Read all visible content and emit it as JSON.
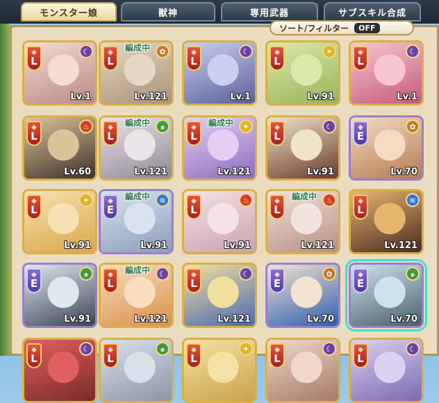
{
  "tabs": [
    {
      "label": "モンスター娘",
      "active": true
    },
    {
      "label": "獣神",
      "active": false
    },
    {
      "label": "専用武器",
      "active": false
    },
    {
      "label": "サブスキル合成",
      "active": false
    }
  ],
  "sort_filter": {
    "label": "ソート/フィルター",
    "state": "OFF"
  },
  "rank_symbols": {
    "L": "L",
    "E": "E"
  },
  "party_label": "編成中",
  "attr_colors": {
    "dark": "#6a3fa8",
    "fire": "#d63c1f",
    "light": "#e0b424",
    "wind": "#3f9a3c",
    "water": "#2f78d6",
    "earth": "#c07a2c"
  },
  "cards": [
    {
      "rank": "L",
      "attr": "dark",
      "level": "Lv.1",
      "party": false,
      "palette": [
        "#f2dccf",
        "#b98a86"
      ]
    },
    {
      "rank": "L",
      "attr": "earth",
      "level": "Lv.121",
      "party": true,
      "palette": [
        "#e6d8c4",
        "#a99278"
      ]
    },
    {
      "rank": "L",
      "attr": "dark",
      "level": "Lv.1",
      "party": false,
      "palette": [
        "#c9d0ef",
        "#5a5f9a"
      ]
    },
    {
      "rank": "L",
      "attr": "light",
      "level": "Lv.91",
      "party": false,
      "palette": [
        "#d9e9a7",
        "#9bb35a"
      ]
    },
    {
      "rank": "L",
      "attr": "dark",
      "level": "Lv.1",
      "party": false,
      "palette": [
        "#f6c7d1",
        "#c65b79"
      ]
    },
    {
      "rank": "L",
      "attr": "fire",
      "level": "Lv.60",
      "party": false,
      "palette": [
        "#d9c49a",
        "#403028"
      ]
    },
    {
      "rank": "L",
      "attr": "wind",
      "level": "Lv.121",
      "party": true,
      "palette": [
        "#e8e4e8",
        "#8e8895"
      ]
    },
    {
      "rank": "L",
      "attr": "light",
      "level": "Lv.121",
      "party": true,
      "palette": [
        "#e1d0f2",
        "#8c6cbf"
      ]
    },
    {
      "rank": "L",
      "attr": "dark",
      "level": "Lv.91",
      "party": false,
      "palette": [
        "#efe3c9",
        "#6a3a2a"
      ]
    },
    {
      "rank": "E",
      "attr": "earth",
      "level": "Lv.70",
      "party": false,
      "palette": [
        "#f3dcc0",
        "#b57b52"
      ]
    },
    {
      "rank": "L",
      "attr": "light",
      "level": "Lv.91",
      "party": false,
      "palette": [
        "#f6e2b0",
        "#d9a64a"
      ]
    },
    {
      "rank": "E",
      "attr": "water",
      "level": "Lv.91",
      "party": true,
      "palette": [
        "#d8e2ee",
        "#8b9eb7"
      ]
    },
    {
      "rank": "L",
      "attr": "fire",
      "level": "Lv.91",
      "party": false,
      "palette": [
        "#f5e1e6",
        "#c9a3ae"
      ]
    },
    {
      "rank": "L",
      "attr": "fire",
      "level": "Lv.121",
      "party": true,
      "palette": [
        "#f2e3dc",
        "#b88f80"
      ]
    },
    {
      "rank": "L",
      "attr": "water",
      "level": "Lv.121",
      "party": false,
      "palette": [
        "#e6b56d",
        "#4a2a22"
      ]
    },
    {
      "rank": "E",
      "attr": "wind",
      "level": "Lv.91",
      "party": false,
      "palette": [
        "#dfe8ef",
        "#3b4558"
      ]
    },
    {
      "rank": "L",
      "attr": "dark",
      "level": "Lv.121",
      "party": true,
      "palette": [
        "#f7dcc0",
        "#d99148"
      ]
    },
    {
      "rank": "L",
      "attr": "dark",
      "level": "Lv.121",
      "party": false,
      "palette": [
        "#f3df9d",
        "#4a6ab3"
      ]
    },
    {
      "rank": "E",
      "attr": "earth",
      "level": "Lv.70",
      "party": false,
      "palette": [
        "#f3e2d0",
        "#2f5fb0"
      ]
    },
    {
      "rank": "E",
      "attr": "wind",
      "level": "Lv.70",
      "party": false,
      "palette": [
        "#cde3ec",
        "#49606c"
      ],
      "selected": true
    },
    {
      "rank": "L",
      "attr": "dark",
      "level": "",
      "party": false,
      "palette": [
        "#e06060",
        "#7a2a2a"
      ]
    },
    {
      "rank": "L",
      "attr": "wind",
      "level": "",
      "party": false,
      "palette": [
        "#d8e0ea",
        "#8b96a8"
      ]
    },
    {
      "rank": "L",
      "attr": "light",
      "level": "",
      "party": false,
      "palette": [
        "#f3e1a6",
        "#c9a34a"
      ]
    },
    {
      "rank": "L",
      "attr": "dark",
      "level": "",
      "party": false,
      "palette": [
        "#f0d8c8",
        "#a57a6a"
      ]
    },
    {
      "rank": "L",
      "attr": "dark",
      "level": "",
      "party": false,
      "palette": [
        "#dcd0f0",
        "#7a6ab0"
      ]
    }
  ]
}
